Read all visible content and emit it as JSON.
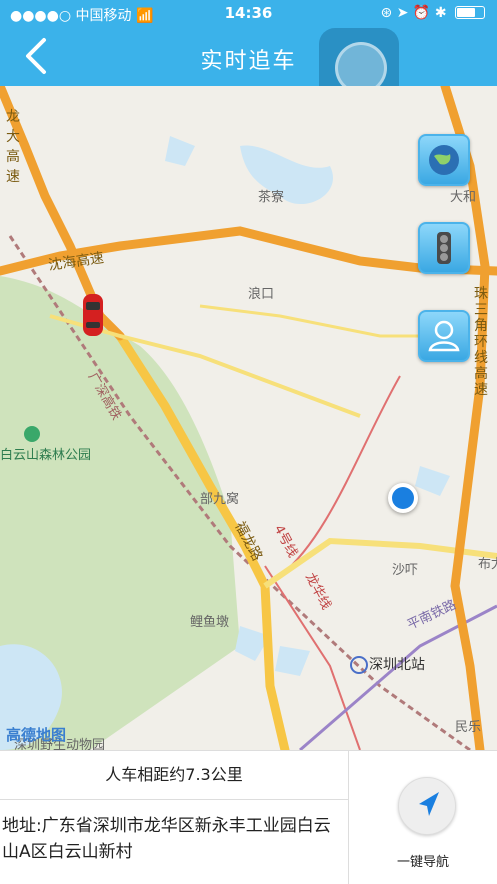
{
  "status_bar": {
    "carrier": "中国移动",
    "time": "14:36"
  },
  "header": {
    "title": "实时追车"
  },
  "map": {
    "labels": {
      "longda_highway": "龙大高速",
      "chaliao": "茶寮",
      "dahe": "大和",
      "shenhai_highway": "沈海高速",
      "langkou": "浪口",
      "zhusanjiao_ring": "珠三角环线高速",
      "guangshen_railway": "广深高铁",
      "baiyunshan_park": "白云山森林公园",
      "bujiuwo": "部九窝",
      "fulong_road": "福龙路",
      "metro_line4": "4号线",
      "longhua_line": "龙华线",
      "shaxia": "沙吓",
      "bu": "布尤",
      "liyudun": "鲤鱼墩",
      "pingnan_railway": "平南铁路",
      "shenzhen_north": "深圳北站",
      "minle": "民乐",
      "zoo": "深圳野生动物园",
      "amap_logo": "高德地图"
    }
  },
  "info": {
    "distance": "人车相距约7.3公里",
    "address": "地址:广东省深圳市龙华区新永丰工业园白云山A区白云山新村",
    "navigate_label": "一键导航"
  }
}
